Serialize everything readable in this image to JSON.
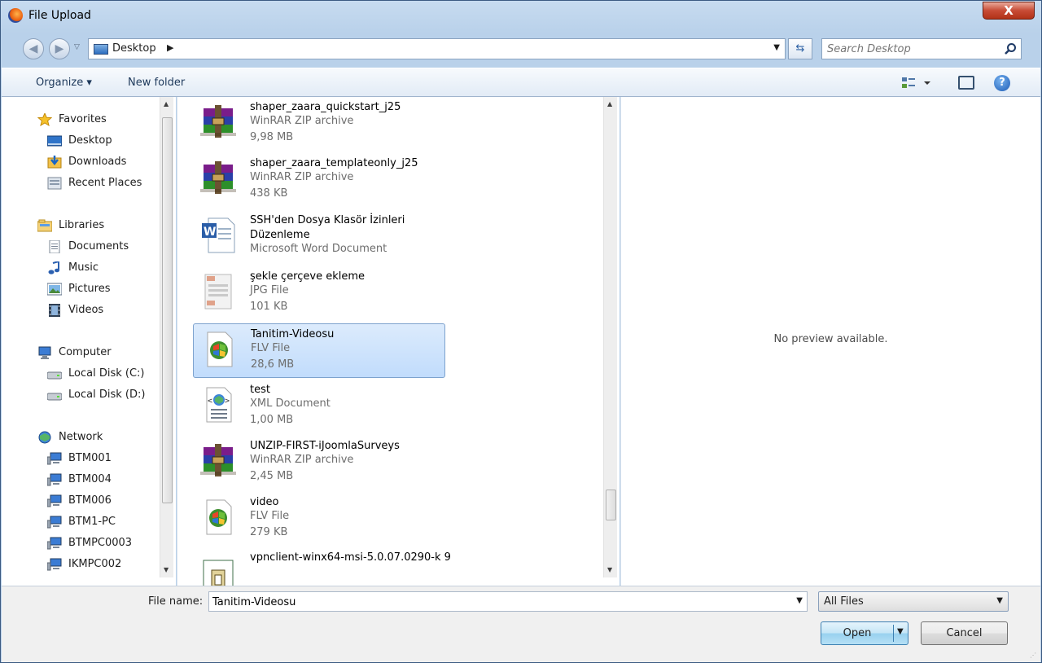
{
  "window": {
    "title": "File Upload",
    "close_label": "X"
  },
  "nav": {
    "address": {
      "location": "Desktop"
    },
    "search": {
      "placeholder": "Search Desktop"
    }
  },
  "toolbar": {
    "organize_label": "Organize ▾",
    "new_folder_label": "New folder"
  },
  "sidebar": {
    "items": [
      {
        "label": "Favorites",
        "icon": "star-icon",
        "group": true
      },
      {
        "label": "Desktop",
        "icon": "desktop-icon"
      },
      {
        "label": "Downloads",
        "icon": "downloads-icon"
      },
      {
        "label": "Recent Places",
        "icon": "recent-places-icon"
      },
      {
        "label": "Libraries",
        "icon": "libraries-icon",
        "group": true
      },
      {
        "label": "Documents",
        "icon": "documents-icon"
      },
      {
        "label": "Music",
        "icon": "music-icon"
      },
      {
        "label": "Pictures",
        "icon": "pictures-icon"
      },
      {
        "label": "Videos",
        "icon": "videos-icon"
      },
      {
        "label": "Computer",
        "icon": "computer-icon",
        "group": true
      },
      {
        "label": "Local Disk (C:)",
        "icon": "disk-icon"
      },
      {
        "label": "Local Disk (D:)",
        "icon": "disk-icon"
      },
      {
        "label": "Network",
        "icon": "network-icon",
        "group": true
      },
      {
        "label": "BTM001",
        "icon": "network-computer-icon"
      },
      {
        "label": "BTM004",
        "icon": "network-computer-icon"
      },
      {
        "label": "BTM006",
        "icon": "network-computer-icon"
      },
      {
        "label": "BTM1-PC",
        "icon": "network-computer-icon"
      },
      {
        "label": "BTMPC0003",
        "icon": "network-computer-icon"
      },
      {
        "label": "IKMPC002",
        "icon": "network-computer-icon"
      }
    ]
  },
  "files": [
    {
      "name": "shaper_zaara_quickstart_j25",
      "type": "WinRAR ZIP archive",
      "size": "9,98 MB",
      "icon": "winrar-archive-icon"
    },
    {
      "name": "shaper_zaara_templateonly_j25",
      "type": "WinRAR ZIP archive",
      "size": "438 KB",
      "icon": "winrar-archive-icon"
    },
    {
      "name": "SSH'den Dosya Klasör İzinleri Düzenleme",
      "type": "Microsoft Word Document",
      "size": "",
      "icon": "word-document-icon"
    },
    {
      "name": "şekle çerçeve ekleme",
      "type": "JPG File",
      "size": "101 KB",
      "icon": "jpg-file-icon"
    },
    {
      "name": "Tanitim-Videosu",
      "type": "FLV File",
      "size": "28,6 MB",
      "icon": "flv-file-icon",
      "selected": true
    },
    {
      "name": "test",
      "type": "XML Document",
      "size": "1,00 MB",
      "icon": "xml-document-icon"
    },
    {
      "name": "UNZIP-FIRST-iJoomlaSurveys",
      "type": "WinRAR ZIP archive",
      "size": "2,45 MB",
      "icon": "winrar-archive-icon"
    },
    {
      "name": "video",
      "type": "FLV File",
      "size": "279 KB",
      "icon": "flv-file-icon"
    },
    {
      "name": "vpnclient-winx64-msi-5.0.07.0290-k 9",
      "type": "",
      "size": "",
      "icon": "installer-icon"
    }
  ],
  "preview": {
    "text": "No preview available."
  },
  "bottom": {
    "file_name_label": "File name:",
    "file_name_value": "Tanitim-Videosu",
    "file_type_value": "All Files",
    "open_label": "Open",
    "cancel_label": "Cancel"
  },
  "colors": {
    "accent": "#3c7fb1",
    "selection": "#c1dcfc",
    "window_frame": "#b9d1ea"
  }
}
